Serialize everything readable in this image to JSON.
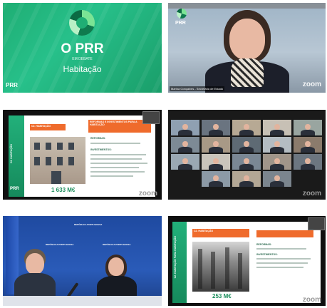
{
  "tiles": {
    "title_slide": {
      "title": "O PRR",
      "subtitle": "EM DEBATE",
      "topic": "Habitação",
      "brand": "PRR"
    },
    "speaker": {
      "brand": "PRR",
      "zoom": "zoom",
      "name_tag": "Marina Gonçalves - Secretária de Estado"
    },
    "housing_slide": {
      "side_label": "C2. HABITAÇÃO",
      "orange_title": "C2. HABITAÇÃO",
      "orange_right": "REFORMAS E INVESTIMENTOS PARA A HABITAÇÃO",
      "section_reforms": "REFORMAS:",
      "section_investments": "INVESTIMENTOS:",
      "amount": "1 633 M€",
      "brand": "PRR",
      "zoom": "zoom"
    },
    "gallery": {
      "zoom": "zoom"
    },
    "press": {
      "backdrop_1": "REPÚBLICA PORTUGUESA",
      "backdrop_2": "REPÚBLICA PORTUGUESA",
      "backdrop_3": "REPÚBLICA PORTUGUESA"
    },
    "bw_slide": {
      "side_label": "C2. HABITAÇÃO PARA HABITAÇÃO",
      "orange_title": "C2. HABITAÇÃO",
      "section_reforms": "REFORMAS:",
      "section_investments": "INVESTIMENTOS:",
      "amount": "253 M€",
      "zoom": "zoom"
    }
  },
  "colors": {
    "green": "#1fae74",
    "orange": "#ef6b2c",
    "blue": "#1f4aa0"
  }
}
